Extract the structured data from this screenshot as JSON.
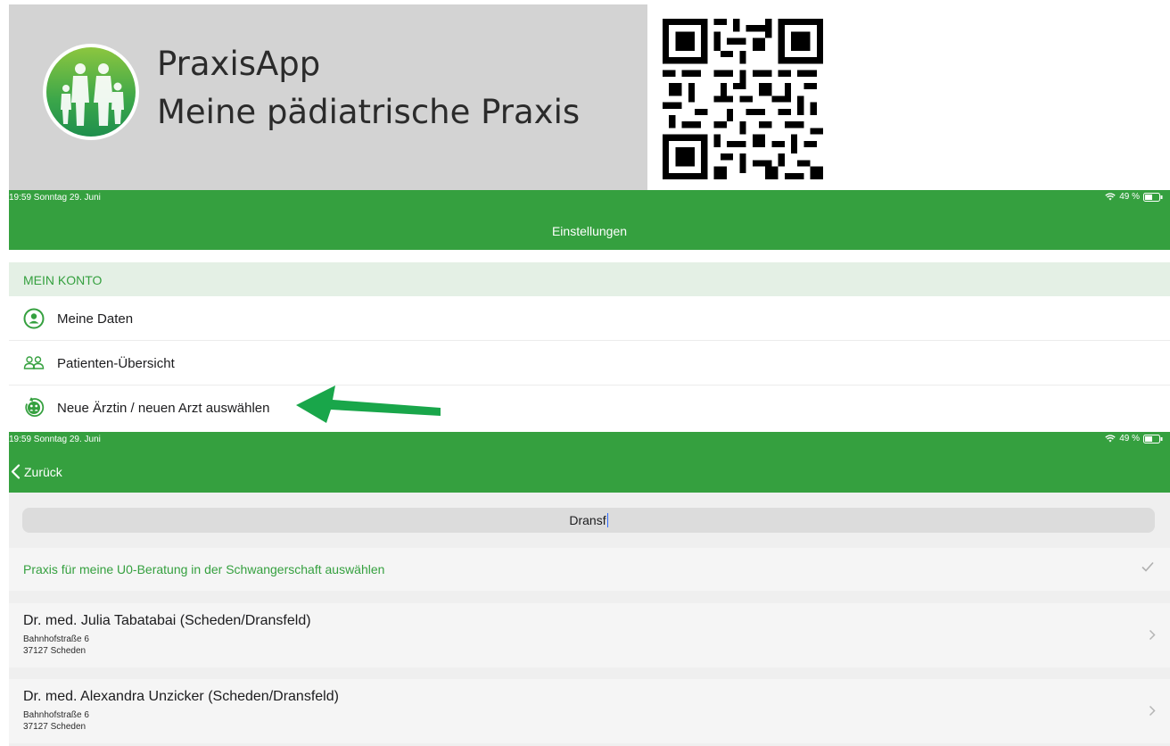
{
  "banner": {
    "app_name": "PraxisApp",
    "tagline": "Meine pädiatrische Praxis"
  },
  "status_bar": {
    "time_date": "19:59  Sonntag 29. Juni",
    "battery": "49 %"
  },
  "settings_screen": {
    "title": "Einstellungen",
    "section_label": "MEIN KONTO",
    "items": [
      {
        "label": "Meine Daten",
        "icon": "person-circle-icon"
      },
      {
        "label": "Patienten-Übersicht",
        "icon": "people-icon"
      },
      {
        "label": "Neue Ärztin / neuen Arzt auswählen",
        "icon": "family-refresh-icon"
      }
    ]
  },
  "search_screen": {
    "back_label": "Zurück",
    "search_value": "Dransf",
    "u0_label": "Praxis für meine U0-Beratung in der Schwangerschaft auswählen",
    "results": [
      {
        "name": "Dr. med. Julia Tabatabai (Scheden/Dransfeld)",
        "street": "Bahnhofstraße 6",
        "city": "37127 Scheden"
      },
      {
        "name": "Dr. med. Alexandra Unzicker (Scheden/Dransfeld)",
        "street": "Bahnhofstraße 6",
        "city": "37127 Scheden"
      }
    ]
  },
  "colors": {
    "primary_green": "#35a03f",
    "section_bg": "#e4f0e5",
    "arrow_green": "#19a64a",
    "banner_bg": "#d3d3d3"
  }
}
